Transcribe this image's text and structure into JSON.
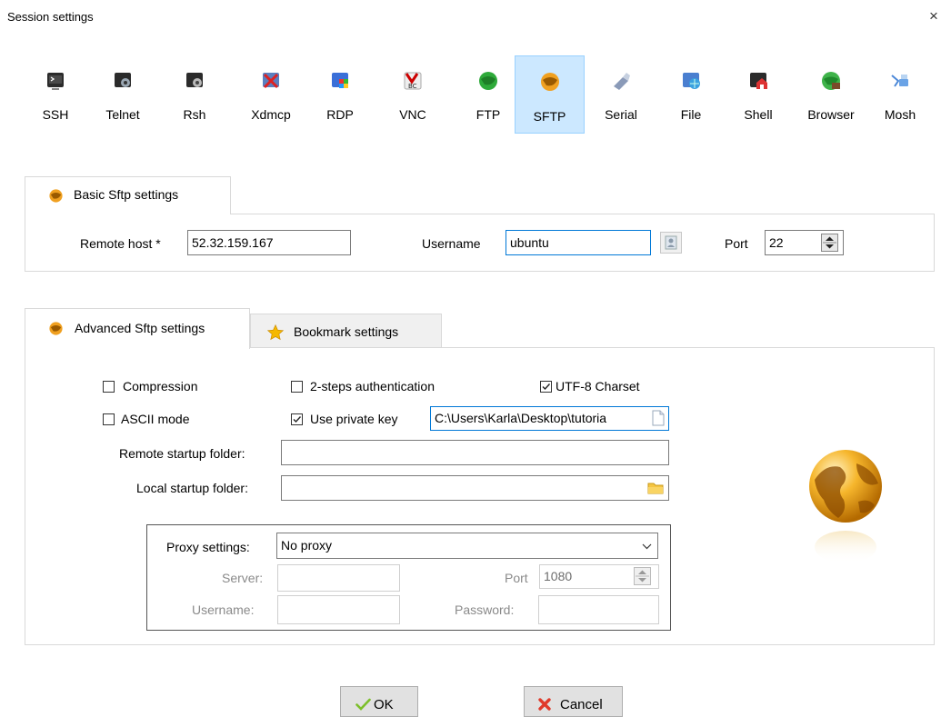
{
  "window": {
    "title": "Session settings",
    "close_glyph": "×"
  },
  "session_types": [
    {
      "label": "SSH",
      "icon": "ssh-icon",
      "selected": false
    },
    {
      "label": "Telnet",
      "icon": "telnet-icon",
      "selected": false
    },
    {
      "label": "Rsh",
      "icon": "rsh-icon",
      "selected": false
    },
    {
      "label": "Xdmcp",
      "icon": "xdmcp-icon",
      "selected": false
    },
    {
      "label": "RDP",
      "icon": "rdp-icon",
      "selected": false
    },
    {
      "label": "VNC",
      "icon": "vnc-icon",
      "selected": false
    },
    {
      "label": "FTP",
      "icon": "ftp-icon",
      "selected": false
    },
    {
      "label": "SFTP",
      "icon": "sftp-icon",
      "selected": true
    },
    {
      "label": "Serial",
      "icon": "serial-icon",
      "selected": false
    },
    {
      "label": "File",
      "icon": "file-icon",
      "selected": false
    },
    {
      "label": "Shell",
      "icon": "shell-icon",
      "selected": false
    },
    {
      "label": "Browser",
      "icon": "browser-icon",
      "selected": false
    },
    {
      "label": "Mosh",
      "icon": "mosh-icon",
      "selected": false
    }
  ],
  "basic": {
    "tab_label": "Basic Sftp settings",
    "remote_host_label": "Remote host *",
    "remote_host_value": "52.32.159.167",
    "username_label": "Username",
    "username_value": "ubuntu",
    "port_label": "Port",
    "port_value": "22"
  },
  "advanced": {
    "tab_label": "Advanced Sftp settings",
    "bookmark_tab_label": "Bookmark settings",
    "compression_label": "Compression",
    "compression_checked": false,
    "two_steps_label": "2-steps authentication",
    "two_steps_checked": false,
    "utf8_label": "UTF-8 Charset",
    "utf8_checked": true,
    "ascii_label": "ASCII mode",
    "ascii_checked": false,
    "private_key_label": "Use private key",
    "private_key_checked": true,
    "private_key_value": "C:\\Users\\Karla\\Desktop\\tutoria",
    "remote_startup_label": "Remote startup folder:",
    "remote_startup_value": "",
    "local_startup_label": "Local startup folder:",
    "local_startup_value": "",
    "proxy": {
      "settings_label": "Proxy settings:",
      "settings_value": "No proxy",
      "server_label": "Server:",
      "server_value": "",
      "port_label": "Port",
      "port_value": "1080",
      "username_label": "Username:",
      "username_value": "",
      "password_label": "Password:",
      "password_value": ""
    }
  },
  "buttons": {
    "ok_label": "OK",
    "cancel_label": "Cancel"
  },
  "colors": {
    "selected_bg": "#cce8ff",
    "selected_border": "#99d1ff",
    "focus_border": "#0078d7",
    "sftp_orange": "#f0a020"
  }
}
